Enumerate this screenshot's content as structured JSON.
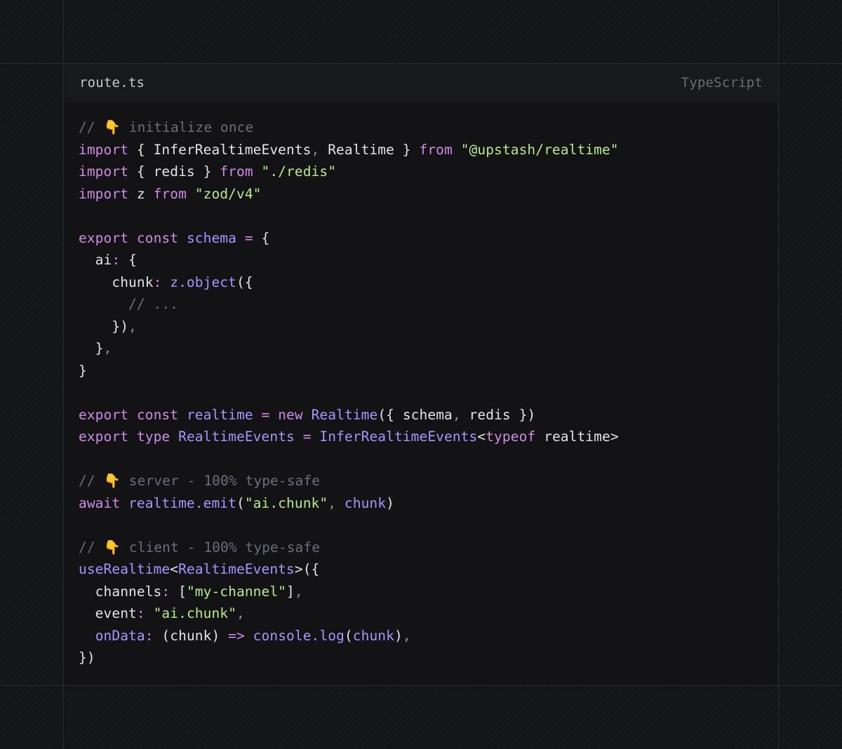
{
  "editor": {
    "file_name": "route.ts",
    "language": "TypeScript"
  },
  "colors": {
    "background": "#141518",
    "panel": "#131316",
    "header": "#18191d",
    "comment": "#6b6e77",
    "keyword": "#d08ae8",
    "string": "#b8ea86",
    "function": "#a795ff",
    "text": "#e3e3e8"
  },
  "code": [
    [
      {
        "t": "comment",
        "v": "// "
      },
      {
        "t": "emoji",
        "v": "👇"
      },
      {
        "t": "comment",
        "v": " initialize once"
      }
    ],
    [
      {
        "t": "keyword",
        "v": "import"
      },
      {
        "t": "plain",
        "v": " { InferRealtimeEvents"
      },
      {
        "t": "punct",
        "v": ","
      },
      {
        "t": "plain",
        "v": " Realtime } "
      },
      {
        "t": "keyword",
        "v": "from"
      },
      {
        "t": "plain",
        "v": " "
      },
      {
        "t": "string",
        "v": "\"@upstash/realtime\""
      }
    ],
    [
      {
        "t": "keyword",
        "v": "import"
      },
      {
        "t": "plain",
        "v": " { redis } "
      },
      {
        "t": "keyword",
        "v": "from"
      },
      {
        "t": "plain",
        "v": " "
      },
      {
        "t": "string",
        "v": "\"./redis\""
      }
    ],
    [
      {
        "t": "keyword",
        "v": "import"
      },
      {
        "t": "plain",
        "v": " z "
      },
      {
        "t": "keyword",
        "v": "from"
      },
      {
        "t": "plain",
        "v": " "
      },
      {
        "t": "string",
        "v": "\"zod/v4\""
      }
    ],
    [],
    [
      {
        "t": "keyword",
        "v": "export"
      },
      {
        "t": "plain",
        "v": " "
      },
      {
        "t": "keyword",
        "v": "const"
      },
      {
        "t": "plain",
        "v": " "
      },
      {
        "t": "func",
        "v": "schema"
      },
      {
        "t": "plain",
        "v": " "
      },
      {
        "t": "keyword",
        "v": "="
      },
      {
        "t": "plain",
        "v": " {"
      }
    ],
    [
      {
        "t": "plain",
        "v": "  ai"
      },
      {
        "t": "keyword",
        "v": ":"
      },
      {
        "t": "plain",
        "v": " {"
      }
    ],
    [
      {
        "t": "plain",
        "v": "    chunk"
      },
      {
        "t": "keyword",
        "v": ":"
      },
      {
        "t": "plain",
        "v": " "
      },
      {
        "t": "func",
        "v": "z.object"
      },
      {
        "t": "plain",
        "v": "({"
      }
    ],
    [
      {
        "t": "comment",
        "v": "      // ..."
      }
    ],
    [
      {
        "t": "plain",
        "v": "    })"
      },
      {
        "t": "punct",
        "v": ","
      }
    ],
    [
      {
        "t": "plain",
        "v": "  }"
      },
      {
        "t": "punct",
        "v": ","
      }
    ],
    [
      {
        "t": "plain",
        "v": "}"
      }
    ],
    [],
    [
      {
        "t": "keyword",
        "v": "export"
      },
      {
        "t": "plain",
        "v": " "
      },
      {
        "t": "keyword",
        "v": "const"
      },
      {
        "t": "plain",
        "v": " "
      },
      {
        "t": "func",
        "v": "realtime"
      },
      {
        "t": "plain",
        "v": " "
      },
      {
        "t": "keyword",
        "v": "="
      },
      {
        "t": "plain",
        "v": " "
      },
      {
        "t": "keyword",
        "v": "new"
      },
      {
        "t": "plain",
        "v": " "
      },
      {
        "t": "func",
        "v": "Realtime"
      },
      {
        "t": "plain",
        "v": "({ schema"
      },
      {
        "t": "punct",
        "v": ","
      },
      {
        "t": "plain",
        "v": " redis })"
      }
    ],
    [
      {
        "t": "keyword",
        "v": "export"
      },
      {
        "t": "plain",
        "v": " "
      },
      {
        "t": "keyword",
        "v": "type"
      },
      {
        "t": "plain",
        "v": " "
      },
      {
        "t": "func",
        "v": "RealtimeEvents"
      },
      {
        "t": "plain",
        "v": " "
      },
      {
        "t": "keyword",
        "v": "="
      },
      {
        "t": "plain",
        "v": " "
      },
      {
        "t": "func",
        "v": "InferRealtimeEvents"
      },
      {
        "t": "plain",
        "v": "<"
      },
      {
        "t": "keyword",
        "v": "typeof"
      },
      {
        "t": "plain",
        "v": " realtime>"
      }
    ],
    [],
    [
      {
        "t": "comment",
        "v": "// "
      },
      {
        "t": "emoji",
        "v": "👇"
      },
      {
        "t": "comment",
        "v": " server - 100% type-safe"
      }
    ],
    [
      {
        "t": "keyword",
        "v": "await"
      },
      {
        "t": "plain",
        "v": " "
      },
      {
        "t": "func",
        "v": "realtime.emit"
      },
      {
        "t": "plain",
        "v": "("
      },
      {
        "t": "string",
        "v": "\"ai.chunk\""
      },
      {
        "t": "punct",
        "v": ","
      },
      {
        "t": "plain",
        "v": " "
      },
      {
        "t": "func",
        "v": "chunk"
      },
      {
        "t": "plain",
        "v": ")"
      }
    ],
    [],
    [
      {
        "t": "comment",
        "v": "// "
      },
      {
        "t": "emoji",
        "v": "👇"
      },
      {
        "t": "comment",
        "v": " client - 100% type-safe"
      }
    ],
    [
      {
        "t": "func",
        "v": "useRealtime"
      },
      {
        "t": "plain",
        "v": "<"
      },
      {
        "t": "func",
        "v": "RealtimeEvents"
      },
      {
        "t": "plain",
        "v": ">({"
      }
    ],
    [
      {
        "t": "plain",
        "v": "  channels"
      },
      {
        "t": "keyword",
        "v": ":"
      },
      {
        "t": "plain",
        "v": " ["
      },
      {
        "t": "string",
        "v": "\"my-channel\""
      },
      {
        "t": "plain",
        "v": "]"
      },
      {
        "t": "punct",
        "v": ","
      }
    ],
    [
      {
        "t": "plain",
        "v": "  event"
      },
      {
        "t": "keyword",
        "v": ":"
      },
      {
        "t": "plain",
        "v": " "
      },
      {
        "t": "string",
        "v": "\"ai.chunk\""
      },
      {
        "t": "punct",
        "v": ","
      }
    ],
    [
      {
        "t": "plain",
        "v": "  "
      },
      {
        "t": "func",
        "v": "onData"
      },
      {
        "t": "keyword",
        "v": ":"
      },
      {
        "t": "plain",
        "v": " (chunk) "
      },
      {
        "t": "keyword",
        "v": "=>"
      },
      {
        "t": "plain",
        "v": " "
      },
      {
        "t": "func",
        "v": "console.log"
      },
      {
        "t": "plain",
        "v": "("
      },
      {
        "t": "func",
        "v": "chunk"
      },
      {
        "t": "plain",
        "v": ")"
      },
      {
        "t": "punct",
        "v": ","
      }
    ],
    [
      {
        "t": "plain",
        "v": "})"
      }
    ]
  ]
}
